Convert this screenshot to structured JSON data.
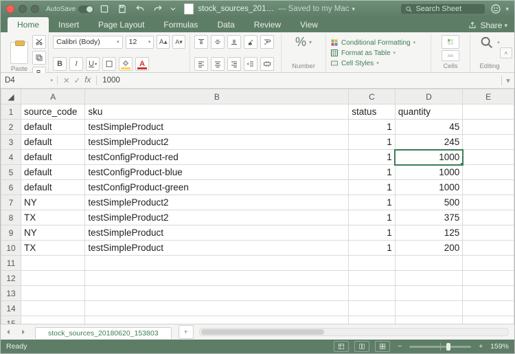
{
  "titlebar": {
    "autosave": "AutoSave",
    "doc_name": "stock_sources_201…",
    "saved_text": "— Saved to my Mac",
    "search_placeholder": "Search Sheet"
  },
  "tabs": {
    "items": [
      "Home",
      "Insert",
      "Page Layout",
      "Formulas",
      "Data",
      "Review",
      "View"
    ],
    "active": 0,
    "share": "Share"
  },
  "ribbon": {
    "paste": "Paste",
    "font_name": "Calibri (Body)",
    "font_size": "12",
    "number": "Number",
    "cond_fmt": "Conditional Formatting",
    "table_fmt": "Format as Table",
    "cell_styles": "Cell Styles",
    "cells": "Cells",
    "editing": "Editing"
  },
  "formula_bar": {
    "cell_ref": "D4",
    "value": "1000"
  },
  "columns": [
    "A",
    "B",
    "C",
    "D",
    "E"
  ],
  "headers": {
    "A": "source_code",
    "B": "sku",
    "C": "status",
    "D": "quantity"
  },
  "rows": [
    {
      "A": "default",
      "B": "testSimpleProduct",
      "C": "1",
      "D": "45"
    },
    {
      "A": "default",
      "B": "testSimpleProduct2",
      "C": "1",
      "D": "245"
    },
    {
      "A": "default",
      "B": "testConfigProduct-red",
      "C": "1",
      "D": "1000"
    },
    {
      "A": "default",
      "B": "testConfigProduct-blue",
      "C": "1",
      "D": "1000"
    },
    {
      "A": "default",
      "B": "testConfigProduct-green",
      "C": "1",
      "D": "1000"
    },
    {
      "A": "NY",
      "B": "testSimpleProduct2",
      "C": "1",
      "D": "500"
    },
    {
      "A": "TX",
      "B": "testSimpleProduct2",
      "C": "1",
      "D": "375"
    },
    {
      "A": "NY",
      "B": "testSimpleProduct",
      "C": "1",
      "D": "125"
    },
    {
      "A": "TX",
      "B": "testSimpleProduct",
      "C": "1",
      "D": "200"
    }
  ],
  "active_cell": {
    "row": 4,
    "col": "D"
  },
  "sheet_tab": "stock_sources_20180620_153803",
  "status": {
    "ready": "Ready",
    "zoom": "159%"
  }
}
